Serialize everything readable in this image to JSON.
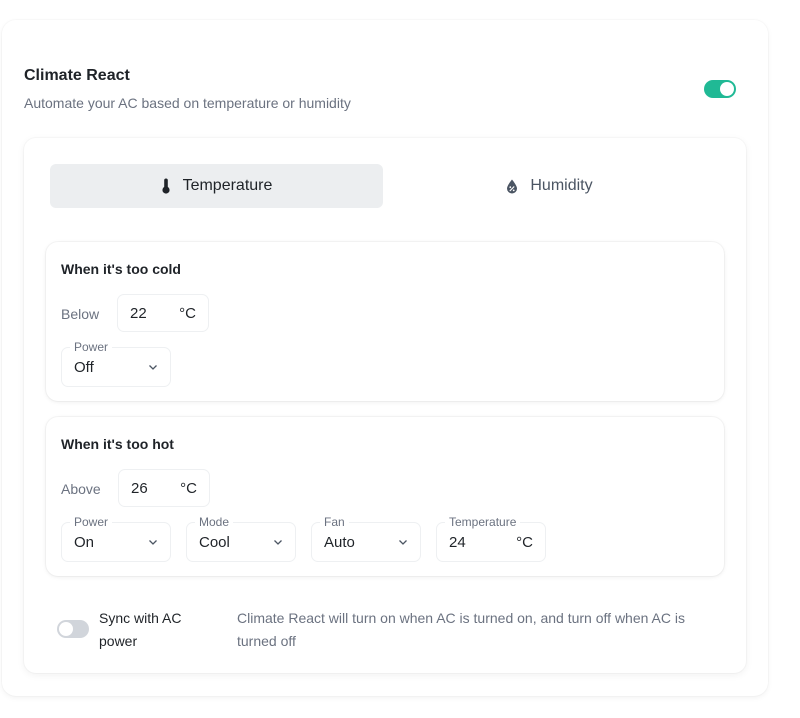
{
  "header": {
    "title": "Climate React",
    "subtitle": "Automate your AC based on temperature or humidity",
    "enabled": true
  },
  "colors": {
    "accent": "#20b995",
    "toggle_off": "#d1d5db",
    "tab_active_bg": "#eceef0"
  },
  "tabs": [
    {
      "label": "Temperature",
      "icon": "thermometer-icon",
      "active": true
    },
    {
      "label": "Humidity",
      "icon": "humidity-drop-icon",
      "active": false
    }
  ],
  "cold": {
    "title": "When it's too cold",
    "threshold_label": "Below",
    "threshold_value": "22",
    "unit": "°C",
    "power": {
      "label": "Power",
      "value": "Off"
    }
  },
  "hot": {
    "title": "When it's too hot",
    "threshold_label": "Above",
    "threshold_value": "26",
    "unit": "°C",
    "power": {
      "label": "Power",
      "value": "On"
    },
    "mode": {
      "label": "Mode",
      "value": "Cool"
    },
    "fan": {
      "label": "Fan",
      "value": "Auto"
    },
    "temperature": {
      "label": "Temperature",
      "value": "24",
      "unit": "°C"
    }
  },
  "sync": {
    "label": "Sync with AC power",
    "enabled": false,
    "description": "Climate React will turn on when AC is turned on, and turn off when AC is turned off"
  }
}
